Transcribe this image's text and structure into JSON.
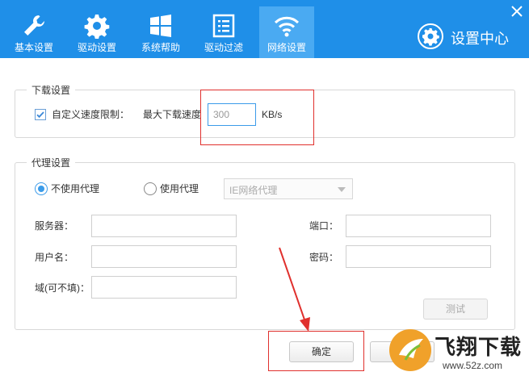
{
  "tabs": [
    {
      "label": "基本设置",
      "icon": "wrench-icon"
    },
    {
      "label": "驱动设置",
      "icon": "gear-icon"
    },
    {
      "label": "系统帮助",
      "icon": "windows-icon"
    },
    {
      "label": "驱动过滤",
      "icon": "list-icon"
    },
    {
      "label": "网络设置",
      "icon": "wifi-icon",
      "active": true
    }
  ],
  "header": {
    "title": "设置中心"
  },
  "download": {
    "legend": "下载设置",
    "limit_checkbox_label": "自定义速度限制：",
    "limit_checked": true,
    "max_speed_label": "最大下载速度",
    "max_speed_value": "300",
    "unit": "KB/s"
  },
  "proxy": {
    "legend": "代理设置",
    "no_proxy_label": "不使用代理",
    "use_proxy_label": "使用代理",
    "selected": "no_proxy",
    "proxy_type_value": "IE网络代理",
    "server_label": "服务器：",
    "port_label": "端口：",
    "username_label": "用户名：",
    "password_label": "密码：",
    "domain_label": "域(可不填)：",
    "test_button": "测试"
  },
  "footer": {
    "ok_button": "确定"
  },
  "watermark": {
    "title": "飞翔下载",
    "subtitle": "www.52z.com"
  },
  "colors": {
    "header_bg": "#1f8fe8",
    "active_tab": "#4aaaf2",
    "highlight_box": "#e0302d"
  }
}
